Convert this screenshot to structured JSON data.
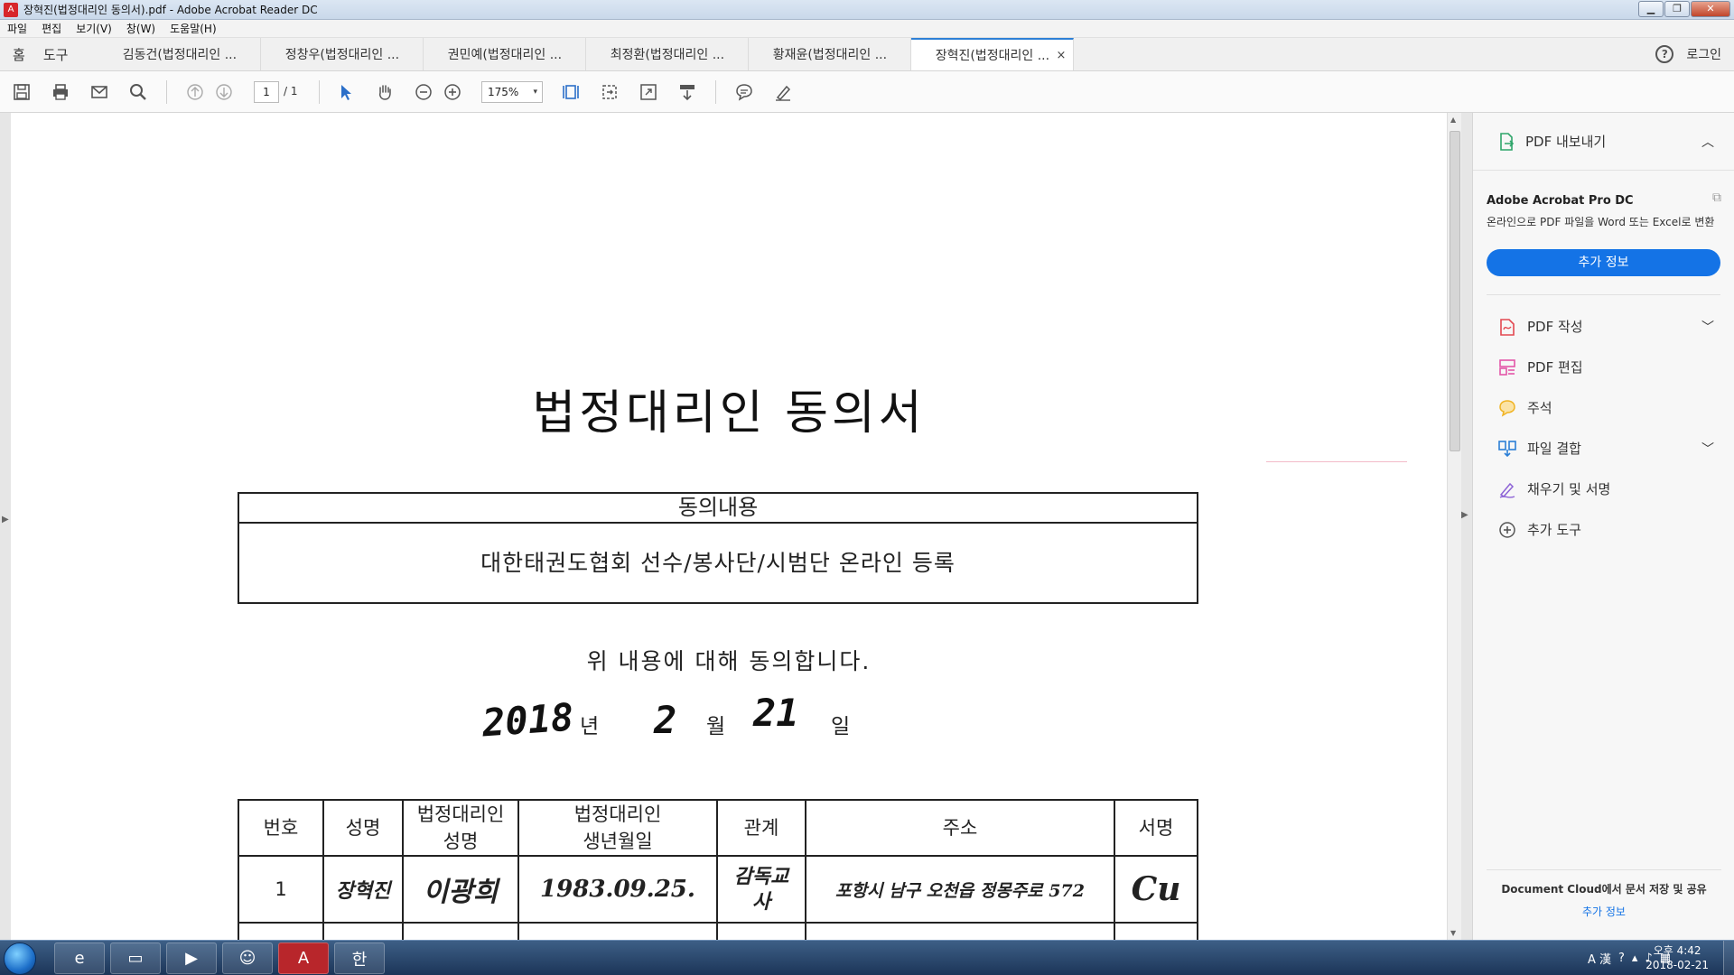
{
  "window": {
    "title": "장혁진(법정대리인 동의서).pdf - Adobe Acrobat Reader DC",
    "app_icon": "pdf-icon"
  },
  "menu": [
    "파일",
    "편집",
    "보기(V)",
    "창(W)",
    "도움말(H)"
  ],
  "tabs": {
    "home": "홈",
    "tools": "도구",
    "documents": [
      {
        "label": "김동건(법정대리인 ..."
      },
      {
        "label": "정창우(법정대리인 ..."
      },
      {
        "label": "권민예(법정대리인 ..."
      },
      {
        "label": "최정환(법정대리인 ..."
      },
      {
        "label": "황재윤(법정대리인 ..."
      },
      {
        "label": "장혁진(법정대리인 ...",
        "active": true
      }
    ],
    "close_glyph": "×",
    "help_glyph": "?",
    "login": "로그인"
  },
  "toolbar": {
    "page_current": "1",
    "page_total": "/ 1",
    "zoom": "175%",
    "zoom_chevron": "▾"
  },
  "document": {
    "title": "법정대리인 동의서",
    "consent_header": "동의내용",
    "consent_content": "대한태권도협회 선수/봉사단/시범단 온라인 등록",
    "agree_text": "위 내용에 대해 동의합니다.",
    "date": {
      "year": "2018",
      "year_label": "년",
      "month": "2",
      "month_label": "월",
      "day": "21",
      "day_label": "일"
    },
    "table": {
      "headers": [
        "번호",
        "성명",
        "법정대리인\n성명",
        "법정대리인\n생년월일",
        "관계",
        "주소",
        "서명"
      ],
      "rows": [
        {
          "no": "1",
          "name": "장혁진",
          "guardian_name": "이광희",
          "guardian_birth": "1983.09.25.",
          "relation": "감독교사",
          "address": "포항시 남구 오천읍 정몽주로 572",
          "signature": "Cu"
        }
      ]
    }
  },
  "right_panel": {
    "export_label": "PDF 내보내기",
    "product": "Adobe Acrobat Pro DC",
    "description": "온라인으로 PDF 파일을 Word 또는 Excel로 변환",
    "more_info_button": "추가 정보",
    "tools": [
      {
        "label": "PDF 작성",
        "icon": "create-pdf-icon",
        "color": "#e34850",
        "expandable": true
      },
      {
        "label": "PDF 편집",
        "icon": "edit-pdf-icon",
        "color": "#e356a8",
        "expandable": false
      },
      {
        "label": "주석",
        "icon": "comment-icon",
        "color": "#f0b323",
        "expandable": false
      },
      {
        "label": "파일 결합",
        "icon": "combine-files-icon",
        "color": "#2b7fd6",
        "expandable": true
      },
      {
        "label": "채우기 및 서명",
        "icon": "fill-sign-icon",
        "color": "#8d63d6",
        "expandable": false
      },
      {
        "label": "추가 도구",
        "icon": "more-tools-icon",
        "color": "#555555",
        "expandable": false
      }
    ],
    "cloud_text": "Document Cloud에서 문서 저장 및 공유",
    "cloud_link": "추가 정보"
  },
  "taskbar": {
    "apps": [
      {
        "icon": "ie-icon",
        "glyph": "e"
      },
      {
        "icon": "explorer-icon",
        "glyph": "▭"
      },
      {
        "icon": "media-player-icon",
        "glyph": "▶"
      },
      {
        "icon": "messenger-icon",
        "glyph": "☺"
      },
      {
        "icon": "acrobat-icon",
        "glyph": "A",
        "active": true
      },
      {
        "icon": "hangul-icon",
        "glyph": "한"
      }
    ],
    "tray_text": "A 漢",
    "time": "오후 4:42",
    "date": "2018-02-21"
  },
  "colors": {
    "accent": "#1473e6",
    "active_tab_border": "#2d7fd6"
  }
}
